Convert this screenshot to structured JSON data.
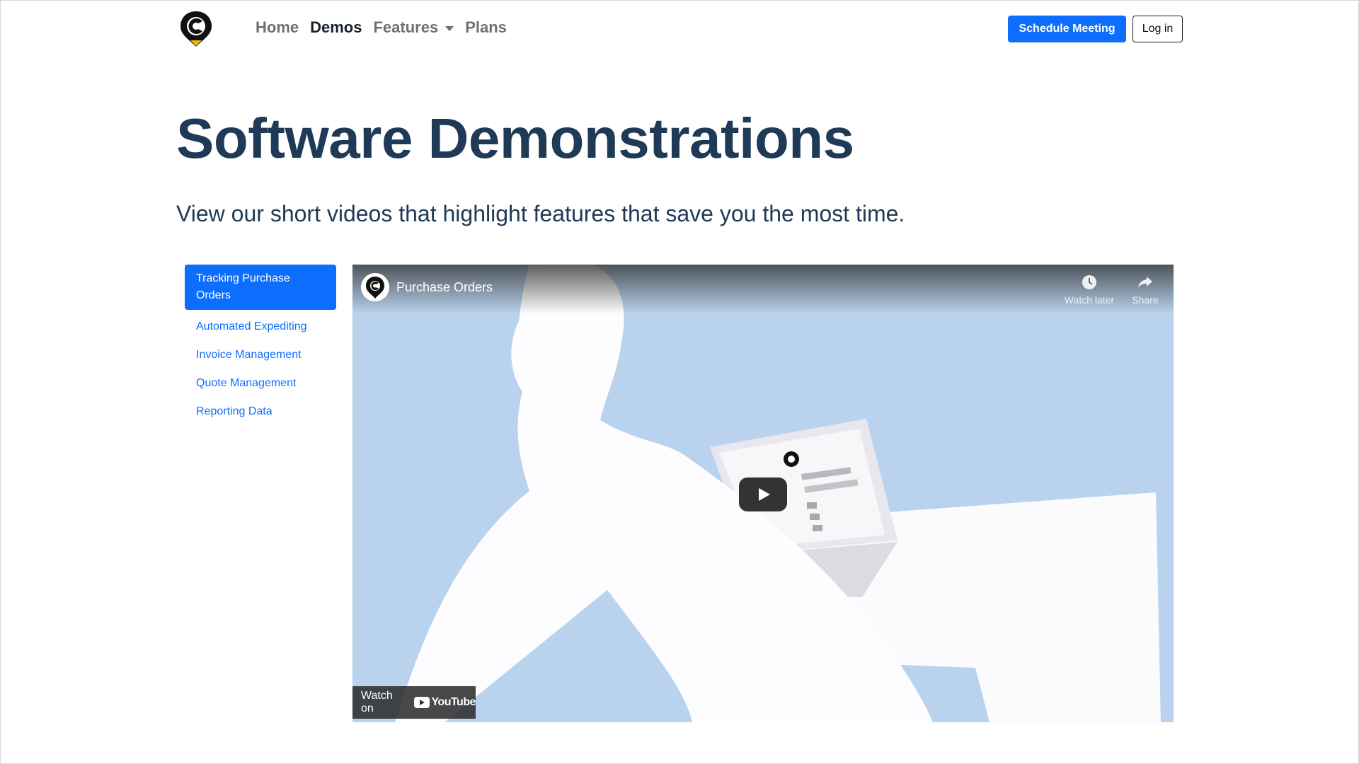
{
  "nav": {
    "links": [
      {
        "label": "Home"
      },
      {
        "label": "Demos"
      },
      {
        "label": "Features"
      },
      {
        "label": "Plans"
      }
    ],
    "schedule_label": "Schedule Meeting",
    "login_label": "Log in"
  },
  "hero": {
    "title": "Software Demonstrations",
    "subtitle": "View our short videos that highlight features that save you the most time."
  },
  "sidebar": {
    "items": [
      {
        "label": "Tracking Purchase Orders",
        "active": true
      },
      {
        "label": "Automated Expediting",
        "active": false
      },
      {
        "label": "Invoice Management",
        "active": false
      },
      {
        "label": "Quote Management",
        "active": false
      },
      {
        "label": "Reporting Data",
        "active": false
      }
    ]
  },
  "video": {
    "title": "Purchase Orders",
    "watch_later_label": "Watch later",
    "share_label": "Share",
    "watch_on_label": "Watch on",
    "youtube_label": "YouTube"
  },
  "colors": {
    "accent": "#0d6efd",
    "heading": "#1e3a56",
    "video_background": "#b9d3ee"
  }
}
